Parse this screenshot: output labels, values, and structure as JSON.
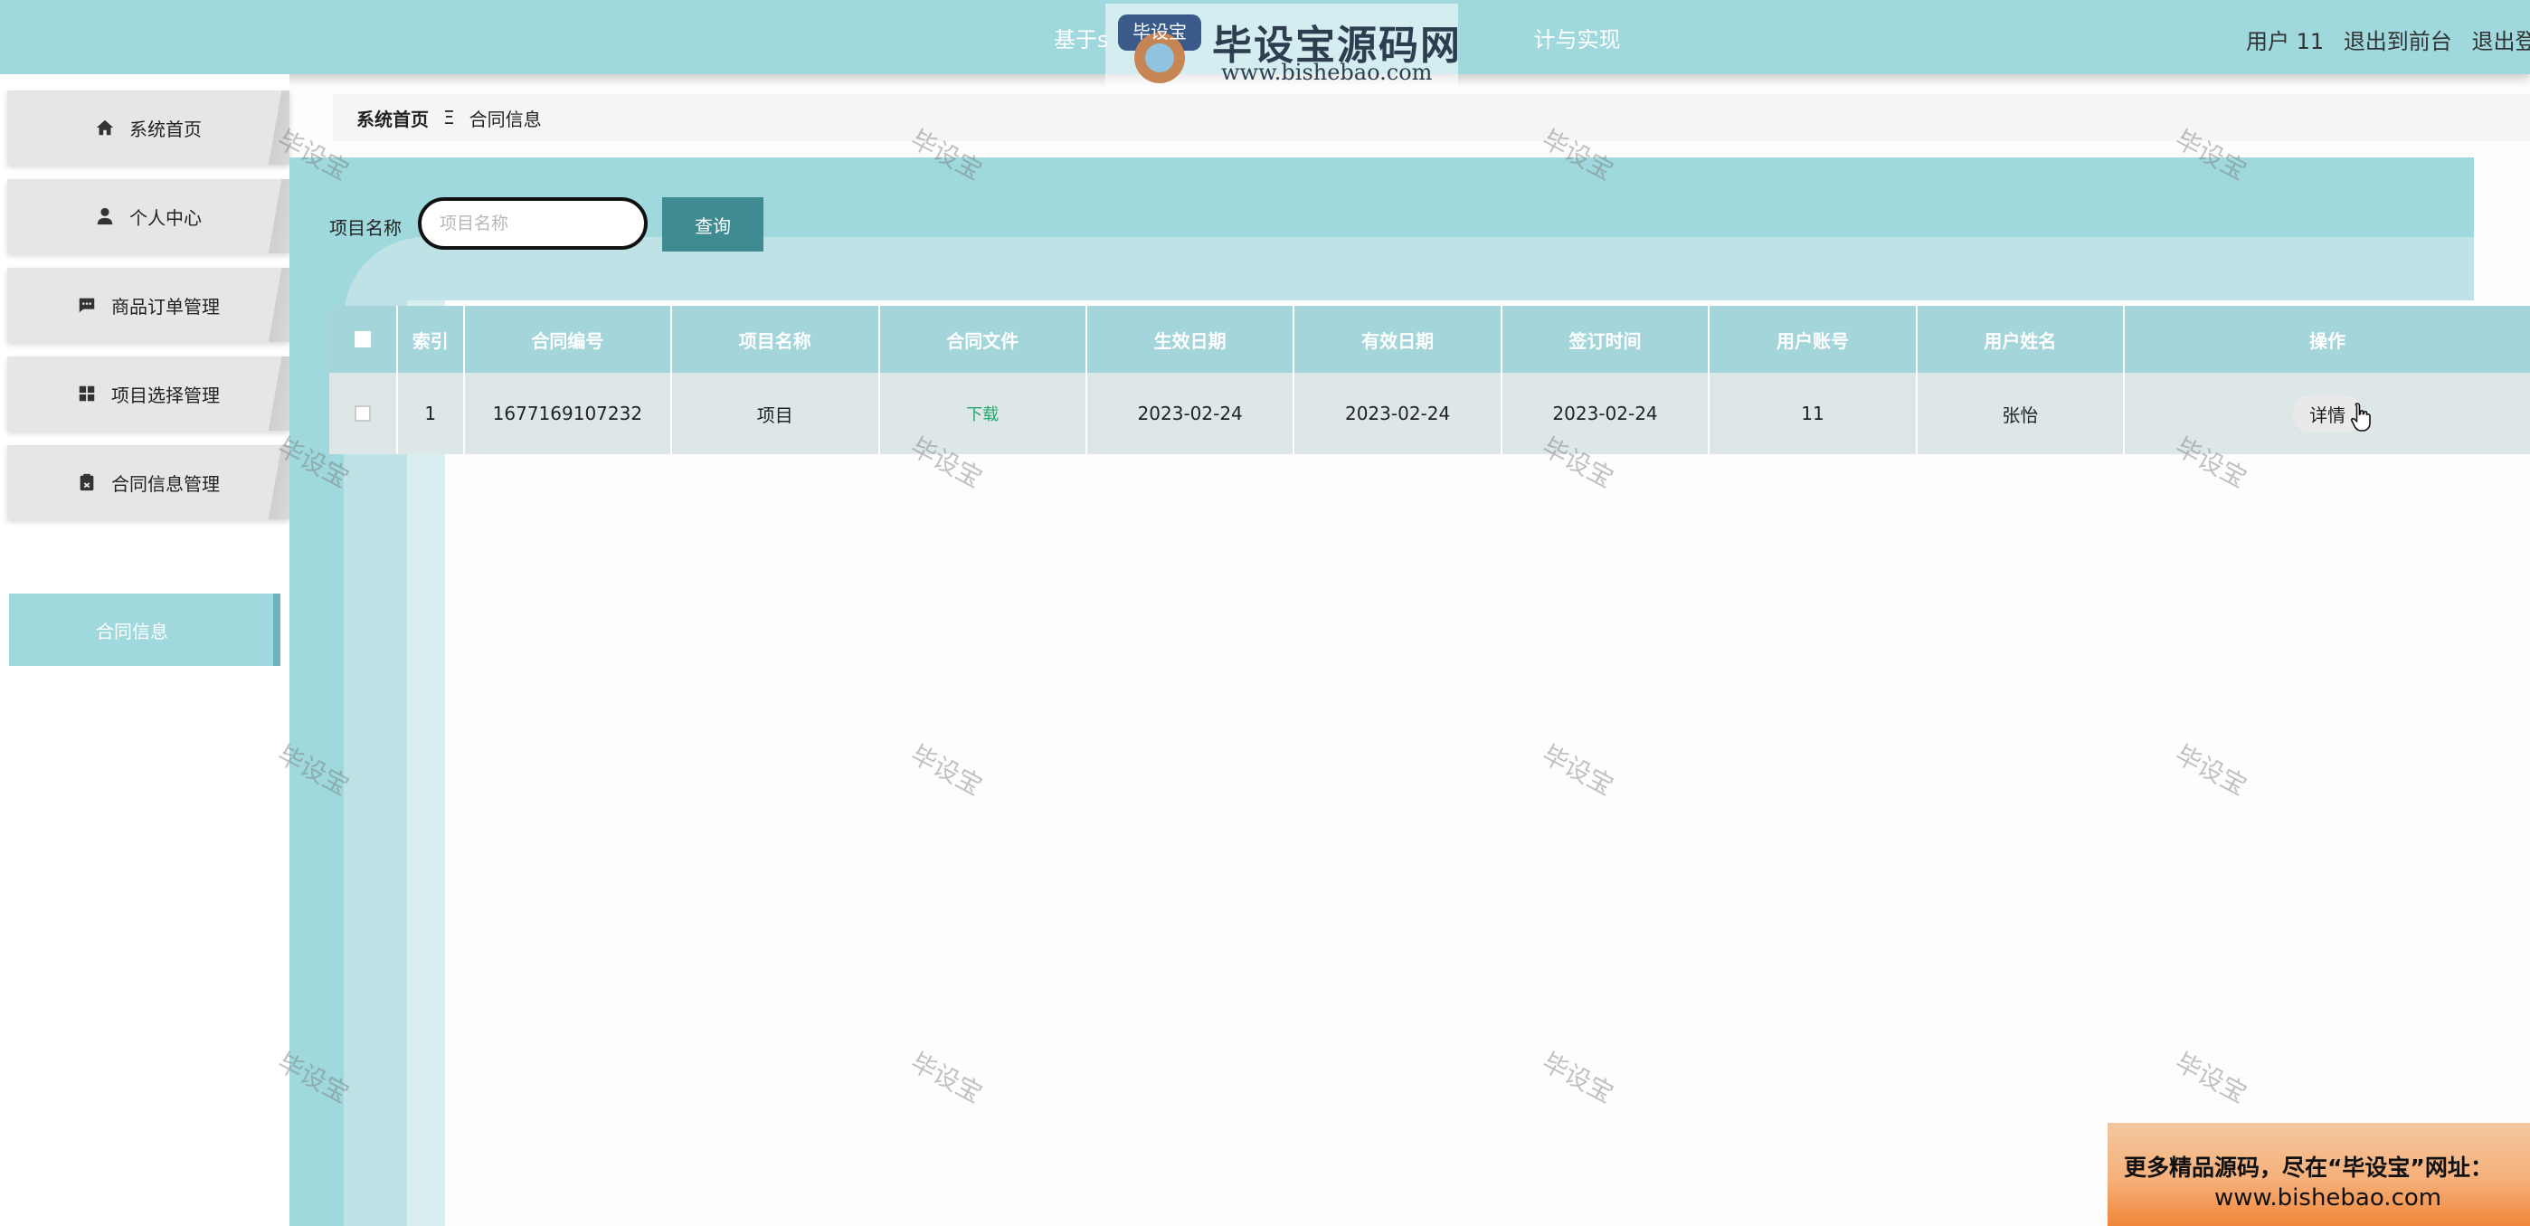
{
  "header": {
    "title_left": "基于s",
    "title_right": "计与实现",
    "logo_text": "毕设宝源码网",
    "logo_url": "www.bishebao.com",
    "logo_badge": "毕设宝",
    "user_label": "用户 11",
    "back_to_front": "退出到前台",
    "logout": "退出登录"
  },
  "sidebar": {
    "items": [
      {
        "label": "系统首页",
        "icon": "home-icon"
      },
      {
        "label": "个人中心",
        "icon": "user-icon"
      },
      {
        "label": "商品订单管理",
        "icon": "chat-icon"
      },
      {
        "label": "项目选择管理",
        "icon": "grid-icon"
      },
      {
        "label": "合同信息管理",
        "icon": "clipboard-icon"
      }
    ],
    "sub_active": "合同信息"
  },
  "breadcrumb": {
    "home": "系统首页",
    "separator": "Ξ",
    "current": "合同信息"
  },
  "search": {
    "label": "项目名称",
    "placeholder": "项目名称",
    "value": "",
    "button": "查询"
  },
  "table": {
    "headers": [
      "索引",
      "合同编号",
      "项目名称",
      "合同文件",
      "生效日期",
      "有效日期",
      "签订时间",
      "用户账号",
      "用户姓名",
      "操作"
    ],
    "rows": [
      {
        "index": "1",
        "contract_no": "1677169107232",
        "project": "项目",
        "file": "下载",
        "start": "2023-02-24",
        "valid": "2023-02-24",
        "signed": "2023-02-24",
        "account": "11",
        "name": "张怡",
        "action": "详情"
      }
    ]
  },
  "watermark": "毕设宝",
  "ad": {
    "line1": "更多精品源码，尽在“毕设宝”网址：",
    "line2": "www.bishebao.com"
  },
  "colors": {
    "header": "#9fd8dd",
    "accent": "#3e8b92",
    "table_header": "#a3d5da",
    "download": "#2aa56f"
  }
}
